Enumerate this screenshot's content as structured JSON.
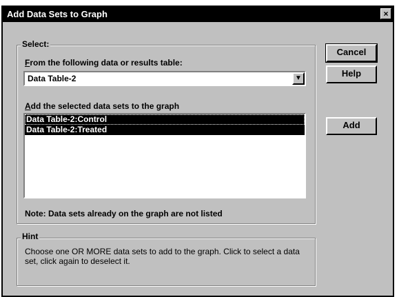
{
  "window": {
    "title": "Add Data Sets to Graph",
    "close_glyph": "×"
  },
  "select_group": {
    "legend": "Select:",
    "table_label_prefix": "F",
    "table_label_rest": "rom the following data or results table:",
    "table_value": "Data Table-2",
    "combo_arrow": "▼",
    "sets_label_prefix": "A",
    "sets_label_rest": "dd the selected data sets to the graph",
    "data_sets": [
      "Data Table-2:Control",
      "Data Table-2:Treated"
    ],
    "note": "Note: Data sets already on the graph are not listed"
  },
  "hint_group": {
    "legend": "Hint",
    "text": "Choose one OR MORE data sets to add to the graph. Click to select a data set, click again to deselect it."
  },
  "buttons": {
    "cancel": "Cancel",
    "help": "Help",
    "add": "Add"
  }
}
